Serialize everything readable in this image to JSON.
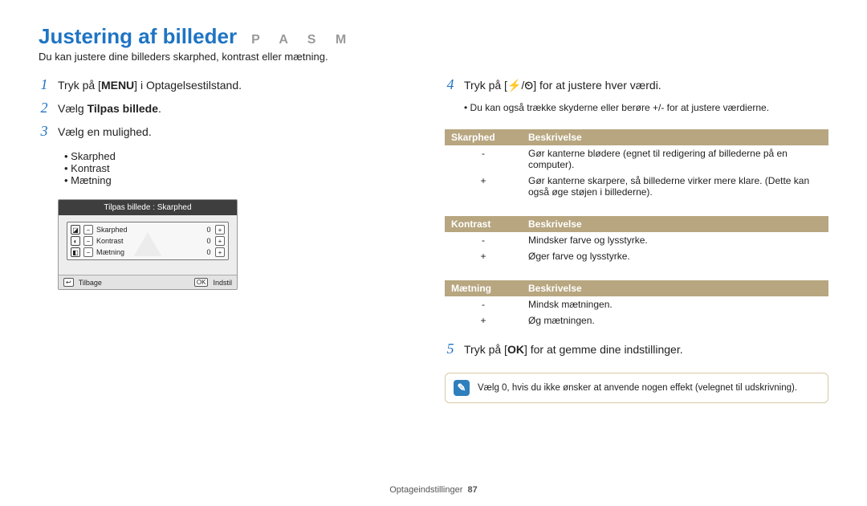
{
  "header": {
    "title": "Justering af billeder",
    "modes": "P A S M",
    "intro": "Du kan justere dine billeders skarphed, kontrast eller mætning."
  },
  "left": {
    "step1": {
      "num": "1",
      "pre": "Tryk på [",
      "chip": "MENU",
      "post": "] i Optagelsestilstand."
    },
    "step2": {
      "num": "2",
      "pre": "Vælg ",
      "bold": "Tilpas billede",
      "post": "."
    },
    "step3": {
      "num": "3",
      "text": "Vælg en mulighed."
    },
    "bullets": {
      "a": "Skarphed",
      "b": "Kontrast",
      "c": "Mætning"
    },
    "screenshot": {
      "title": "Tilpas billede : Skarphed",
      "rows": {
        "r1": {
          "ico": "◪",
          "label": "Skarphed",
          "val": "0"
        },
        "r2": {
          "ico": "◐",
          "label": "Kontrast",
          "val": "0"
        },
        "r3": {
          "ico": "◧",
          "label": "Mætning",
          "val": "0"
        }
      },
      "footer": {
        "back_key": "↩",
        "back_label": "Tilbage",
        "ok_key": "OK",
        "ok_label": "Indstil"
      }
    }
  },
  "right": {
    "step4": {
      "num": "4",
      "pre": "Tryk på [",
      "chipA": "⚡",
      "sep": "/",
      "chipB": "⏲",
      "post": "] for at justere hver værdi."
    },
    "step4_note": "Du kan også trække skyderne eller berøre +/- for at justere værdierne.",
    "t1": {
      "h1": "Skarphed",
      "h2": "Beskrivelse",
      "r1k": "-",
      "r1v": "Gør kanterne blødere (egnet til redigering af billederne på en computer).",
      "r2k": "+",
      "r2v": "Gør kanterne skarpere, så billederne virker mere klare. (Dette kan også øge støjen i billederne)."
    },
    "t2": {
      "h1": "Kontrast",
      "h2": "Beskrivelse",
      "r1k": "-",
      "r1v": "Mindsker farve og lysstyrke.",
      "r2k": "+",
      "r2v": "Øger farve og lysstyrke."
    },
    "t3": {
      "h1": "Mætning",
      "h2": "Beskrivelse",
      "r1k": "-",
      "r1v": "Mindsk mætningen.",
      "r2k": "+",
      "r2v": "Øg mætningen."
    },
    "step5": {
      "num": "5",
      "pre": "Tryk på [",
      "chip": "OK",
      "post": "] for at gemme dine indstillinger."
    },
    "info_icon": "✎",
    "info": "Vælg 0, hvis du ikke ønsker at anvende nogen effekt (velegnet til udskrivning)."
  },
  "footer": {
    "section": "Optageindstillinger",
    "page": "87"
  }
}
